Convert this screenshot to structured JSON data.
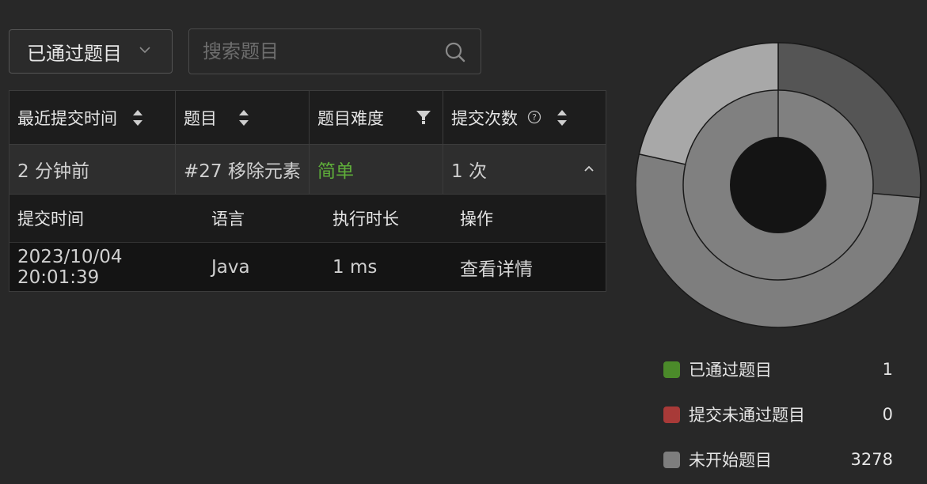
{
  "filter": {
    "selected": "已通过题目"
  },
  "search": {
    "placeholder": "搜索题目"
  },
  "table": {
    "headers": {
      "time": "最近提交时间",
      "problem": "题目",
      "difficulty": "题目难度",
      "count": "提交次数"
    },
    "row": {
      "time": "2 分钟前",
      "problem": "#27 移除元素",
      "difficulty": "简单",
      "count": "1 次"
    },
    "sub_headers": {
      "submit_time": "提交时间",
      "language": "语言",
      "runtime": "执行时长",
      "action": "操作"
    },
    "sub_row": {
      "submit_time": "2023/10/04 20:01:39",
      "language": "Java",
      "runtime": "1 ms",
      "action": "查看详情"
    }
  },
  "chart_data": {
    "type": "pie",
    "legend": [
      {
        "label": "已通过题目",
        "count": "1",
        "color": "#4b8a2a"
      },
      {
        "label": "提交未通过题目",
        "count": "0",
        "color": "#a83a38"
      },
      {
        "label": "未开始题目",
        "count": "3278",
        "color": "#7e7e7e"
      }
    ]
  },
  "colors": {
    "background": "#282828",
    "easy": "#5fae3a"
  }
}
